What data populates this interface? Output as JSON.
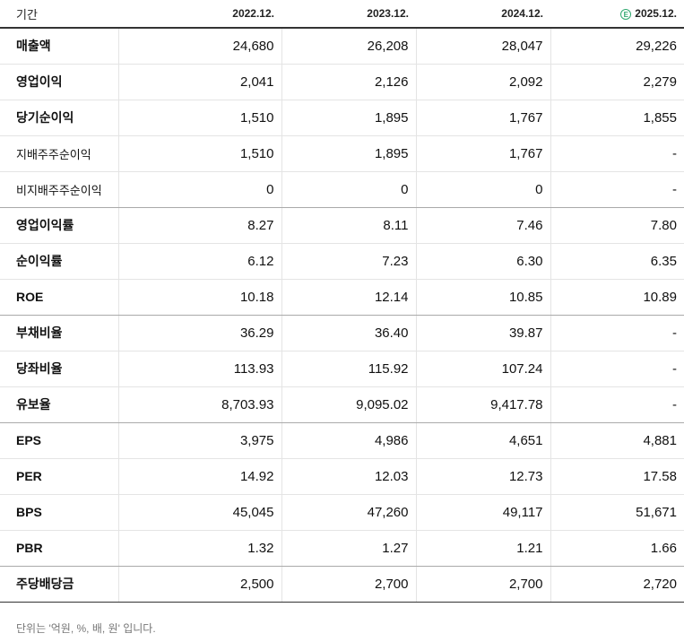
{
  "header": {
    "label": "기간",
    "columns": [
      {
        "label": "2022.12.",
        "estimate": false
      },
      {
        "label": "2023.12.",
        "estimate": false
      },
      {
        "label": "2024.12.",
        "estimate": false
      },
      {
        "label": "2025.12.",
        "estimate": true,
        "estimate_mark": "E"
      }
    ]
  },
  "rows": [
    {
      "label": "매출액",
      "values": [
        "24,680",
        "26,208",
        "28,047",
        "29,226"
      ]
    },
    {
      "label": "영업이익",
      "values": [
        "2,041",
        "2,126",
        "2,092",
        "2,279"
      ]
    },
    {
      "label": "당기순이익",
      "values": [
        "1,510",
        "1,895",
        "1,767",
        "1,855"
      ]
    },
    {
      "label": "지배주주순이익",
      "values": [
        "1,510",
        "1,895",
        "1,767",
        "-"
      ]
    },
    {
      "label": "비지배주주순이익",
      "values": [
        "0",
        "0",
        "0",
        "-"
      ]
    },
    {
      "label": "영업이익률",
      "values": [
        "8.27",
        "8.11",
        "7.46",
        "7.80"
      ]
    },
    {
      "label": "순이익률",
      "values": [
        "6.12",
        "7.23",
        "6.30",
        "6.35"
      ]
    },
    {
      "label": "ROE",
      "values": [
        "10.18",
        "12.14",
        "10.85",
        "10.89"
      ]
    },
    {
      "label": "부채비율",
      "values": [
        "36.29",
        "36.40",
        "39.87",
        "-"
      ]
    },
    {
      "label": "당좌비율",
      "values": [
        "113.93",
        "115.92",
        "107.24",
        "-"
      ]
    },
    {
      "label": "유보율",
      "values": [
        "8,703.93",
        "9,095.02",
        "9,417.78",
        "-"
      ]
    },
    {
      "label": "EPS",
      "values": [
        "3,975",
        "4,986",
        "4,651",
        "4,881"
      ]
    },
    {
      "label": "PER",
      "values": [
        "14.92",
        "12.03",
        "12.73",
        "17.58"
      ]
    },
    {
      "label": "BPS",
      "values": [
        "45,045",
        "47,260",
        "49,117",
        "51,671"
      ]
    },
    {
      "label": "PBR",
      "values": [
        "1.32",
        "1.27",
        "1.21",
        "1.66"
      ]
    },
    {
      "label": "주당배당금",
      "values": [
        "2,500",
        "2,700",
        "2,700",
        "2,720"
      ]
    }
  ],
  "footnote": "단위는 '억원, %, 배, 원' 입니다."
}
